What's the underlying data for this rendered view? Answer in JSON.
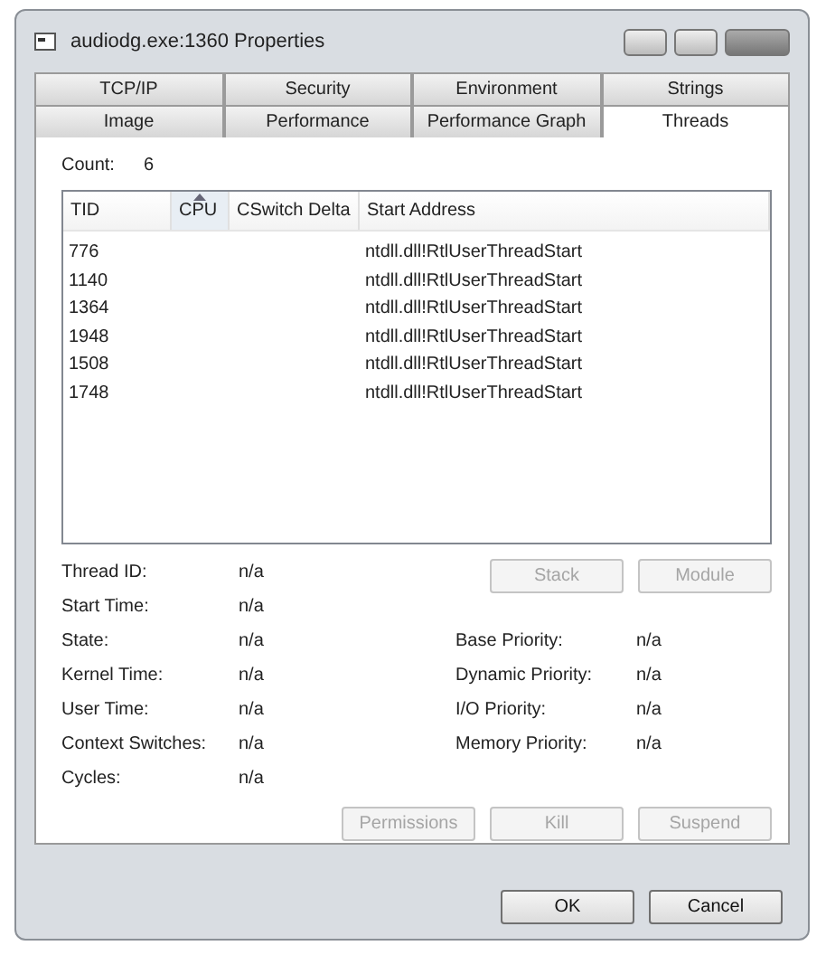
{
  "window": {
    "title": "audiodg.exe:1360 Properties"
  },
  "tab_rows": [
    [
      {
        "label": "TCP/IP",
        "selected": false
      },
      {
        "label": "Security",
        "selected": false
      },
      {
        "label": "Environment",
        "selected": false
      },
      {
        "label": "Strings",
        "selected": false
      }
    ],
    [
      {
        "label": "Image",
        "selected": false
      },
      {
        "label": "Performance",
        "selected": false
      },
      {
        "label": "Performance Graph",
        "selected": false
      },
      {
        "label": "Threads",
        "selected": true
      }
    ]
  ],
  "count": {
    "label": "Count:",
    "value": "6"
  },
  "table": {
    "columns": [
      {
        "label": "TID",
        "sorted": false
      },
      {
        "label": "CPU",
        "sorted": true
      },
      {
        "label": "CSwitch Delta",
        "sorted": false
      },
      {
        "label": "Start Address",
        "sorted": false
      }
    ],
    "rows": [
      [
        "776",
        "",
        "",
        "ntdll.dll!RtlUserThreadStart"
      ],
      [
        "1140",
        "",
        "",
        "ntdll.dll!RtlUserThreadStart"
      ],
      [
        "1364",
        "",
        "",
        "ntdll.dll!RtlUserThreadStart"
      ],
      [
        "1948",
        "",
        "",
        "ntdll.dll!RtlUserThreadStart"
      ],
      [
        "1508",
        "",
        "",
        "ntdll.dll!RtlUserThreadStart"
      ],
      [
        "1748",
        "",
        "",
        "ntdll.dll!RtlUserThreadStart"
      ]
    ]
  },
  "thread_buttons": [
    {
      "label": "Stack",
      "disabled": true
    },
    {
      "label": "Module",
      "disabled": true
    }
  ],
  "details_left": [
    {
      "label": "Thread ID:",
      "value": "n/a"
    },
    {
      "label": "Start Time:",
      "value": "n/a"
    },
    {
      "label": "State:",
      "value": "n/a"
    },
    {
      "label": "Kernel Time:",
      "value": "n/a"
    },
    {
      "label": "User Time:",
      "value": "n/a"
    },
    {
      "label": "Context Switches:",
      "value": "n/a"
    },
    {
      "label": "Cycles:",
      "value": "n/a"
    }
  ],
  "details_right": [
    {
      "label": "Base Priority:",
      "value": "n/a"
    },
    {
      "label": "Dynamic Priority:",
      "value": "n/a"
    },
    {
      "label": "I/O Priority:",
      "value": "n/a"
    },
    {
      "label": "Memory Priority:",
      "value": "n/a"
    }
  ],
  "action_buttons": [
    {
      "label": "Permissions",
      "disabled": true
    },
    {
      "label": "Kill",
      "disabled": true
    },
    {
      "label": "Suspend",
      "disabled": true
    }
  ],
  "dialog_buttons": [
    {
      "label": "OK",
      "disabled": false
    },
    {
      "label": "Cancel",
      "disabled": false
    }
  ]
}
